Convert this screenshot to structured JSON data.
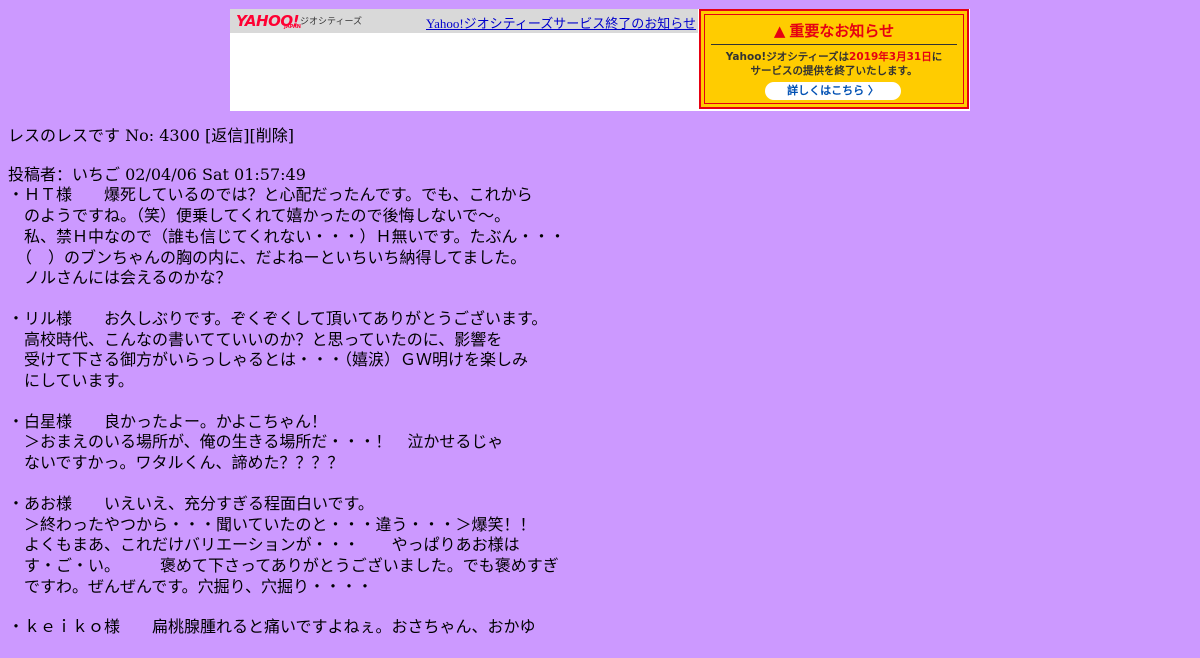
{
  "banner": {
    "logo": "YAHOO!",
    "logo_sub": "JAPAN",
    "service_label": "ジオシティーズ",
    "end_link": "Yahoo!ジオシティーズサービス終了のお知らせ",
    "notice_title": "重要なお知らせ",
    "notice_line1_pre": "Yahoo!ジオシティーズは",
    "notice_date": "2019年3月31日",
    "notice_line1_post": "に",
    "notice_line2": "サービスの提供を終了いたします。",
    "notice_button": "詳しくはこちら 〉"
  },
  "post": {
    "heading": "レスのレスです No: 4300 [返信][削除]",
    "poster": "投稿者：いちご 02/04/06 Sat 01:57:49",
    "paragraphs": [
      "・ＨＴ様　　爆死しているのでは？と心配だったんです。でも、これから\n　のようですね。（笑）便乗してくれて嬉かったので後悔しないで～。\n　私、禁Ｈ中なので（誰も信じてくれない・・・）Ｈ無いです。たぶん・・・\n　（　）のブンちゃんの胸の内に、だよねーといちいち納得してました。\n　ノルさんには会えるのかな？",
      "・リル様　　お久しぶりです。ぞくぞくして頂いてありがとうございます。\n　高校時代、こんなの書いてていいのか？と思っていたのに、影響を\n　受けて下さる御方がいらっしゃるとは・・・（嬉涙）ＧＷ明けを楽しみ\n　にしています。",
      "・白星様　　良かったよー。かよこちゃん！\n　＞おまえのいる場所が、俺の生きる場所だ・・・！　泣かせるじゃ\n　ないですかっ。ワタルくん、諦めた？？？？",
      "・あお様　　いえいえ、充分すぎる程面白いです。\n　＞終わったやつから・・・聞いていたのと・・・違う・・・＞爆笑！！\n　よくもまあ、これだけバリエーションが・・・　　やっぱりあお様は\n　す・ご・い。　　　褒めて下さってありがとうございました。でも褒めすぎ\n　ですわ。ぜんぜんです。穴掘り、穴掘り・・・・",
      "・ｋｅｉｋｏ様　　扁桃腺腫れると痛いですよねぇ。おさちゃん、おかゆ"
    ]
  }
}
